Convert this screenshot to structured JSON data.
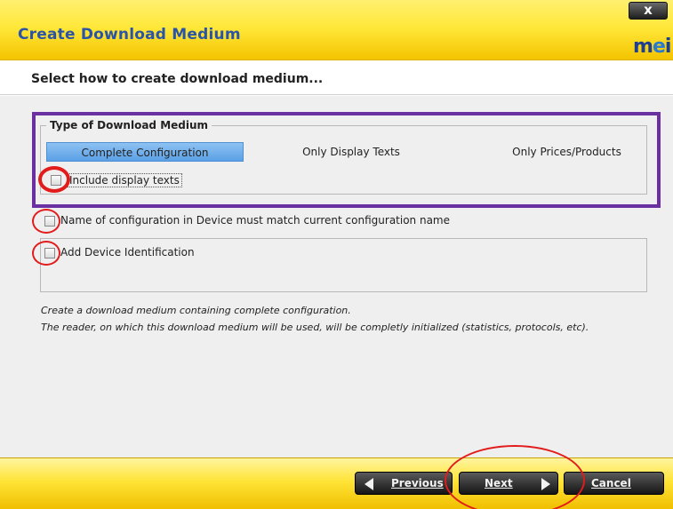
{
  "window": {
    "title": "Create Download Medium",
    "close_label": "x",
    "logo_text_1": "m",
    "logo_text_2": "e",
    "logo_text_3": "i"
  },
  "subheader": {
    "text": "Select how to create download medium..."
  },
  "type_group": {
    "legend": "Type of Download Medium",
    "options": [
      {
        "label": "Complete Configuration",
        "selected": true
      },
      {
        "label": "Only Display Texts",
        "selected": false
      },
      {
        "label": "Only Prices/Products",
        "selected": false
      }
    ],
    "include_display_texts": {
      "label": "Include display texts",
      "checked": false
    }
  },
  "match_config_name": {
    "label": "Name of configuration in Device must match current configuration name",
    "checked": false
  },
  "add_device_identification": {
    "label": "Add Device Identification",
    "checked": false
  },
  "description": {
    "line1": "Create a download medium containing complete configuration.",
    "line2": "The reader, on which this download medium will be used, will be completly initialized (statistics, protocols, etc)."
  },
  "footer": {
    "previous_label": "Previous",
    "next_label": "Next",
    "cancel_label": "Cancel"
  },
  "colors": {
    "titlebar": "#ffe83a",
    "title_text": "#2a54a8",
    "selected_option": "#5aa0e6",
    "annotation_purple": "#6a2fa0",
    "annotation_red": "#e21b1b"
  }
}
